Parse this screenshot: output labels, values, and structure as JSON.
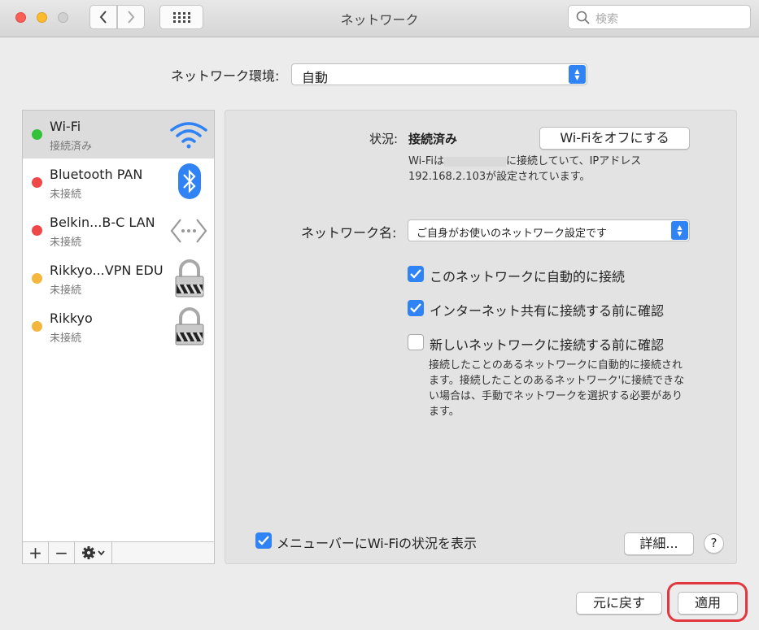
{
  "window": {
    "title": "ネットワーク"
  },
  "search": {
    "placeholder": "検索"
  },
  "location": {
    "label": "ネットワーク環境:",
    "value": "自動"
  },
  "services": [
    {
      "name": "Wi-Fi",
      "status": "接続済み",
      "dot_color": "#34c13a",
      "icon": "wifi-icon"
    },
    {
      "name": "Bluetooth PAN",
      "status": "未接続",
      "dot_color": "#f04848",
      "icon": "bluetooth-icon"
    },
    {
      "name": "Belkin...B-C LAN",
      "status": "未接続",
      "dot_color": "#f04848",
      "icon": "ethernet-icon"
    },
    {
      "name": "Rikkyo...VPN EDU",
      "status": "未接続",
      "dot_color": "#f4b63c",
      "icon": "lock-icon"
    },
    {
      "name": "Rikkyo",
      "status": "未接続",
      "dot_color": "#f4b63c",
      "icon": "lock-icon"
    }
  ],
  "list_toolbar": {
    "add": "+",
    "remove": "−"
  },
  "detail": {
    "status_label": "状況:",
    "status_value": "接続済み",
    "wifi_off_button": "Wi-Fiをオフにする",
    "status_desc_1a": "Wi-Fiは",
    "status_desc_1b": "に接続していて、IPアドレス",
    "status_desc_2": "192.168.2.103が設定されています。",
    "network_name_label": "ネットワーク名:",
    "network_name_value": "ご自身がお使いのネットワーク設定です",
    "checkboxes": [
      {
        "label": "このネットワークに自動的に接続",
        "checked": true
      },
      {
        "label": "インターネット共有に接続する前に確認",
        "checked": true
      },
      {
        "label": "新しいネットワークに接続する前に確認",
        "checked": false
      }
    ],
    "ask_desc": [
      "接続したことのあるネットワークに自動的に接続され",
      "ます。接続したことのあるネットワーク'に接続できな",
      "い場合は、手動でネットワークを選択する必要があり",
      "ます。"
    ],
    "menubar_label": "メニューバーにWi-Fiの状況を表示",
    "menubar_checked": true,
    "advanced_button": "詳細...",
    "help_button": "?"
  },
  "footer": {
    "revert_button": "元に戻す",
    "apply_button": "適用"
  },
  "colors": {
    "accent": "#2f83f5",
    "highlight": "#e0383e"
  }
}
